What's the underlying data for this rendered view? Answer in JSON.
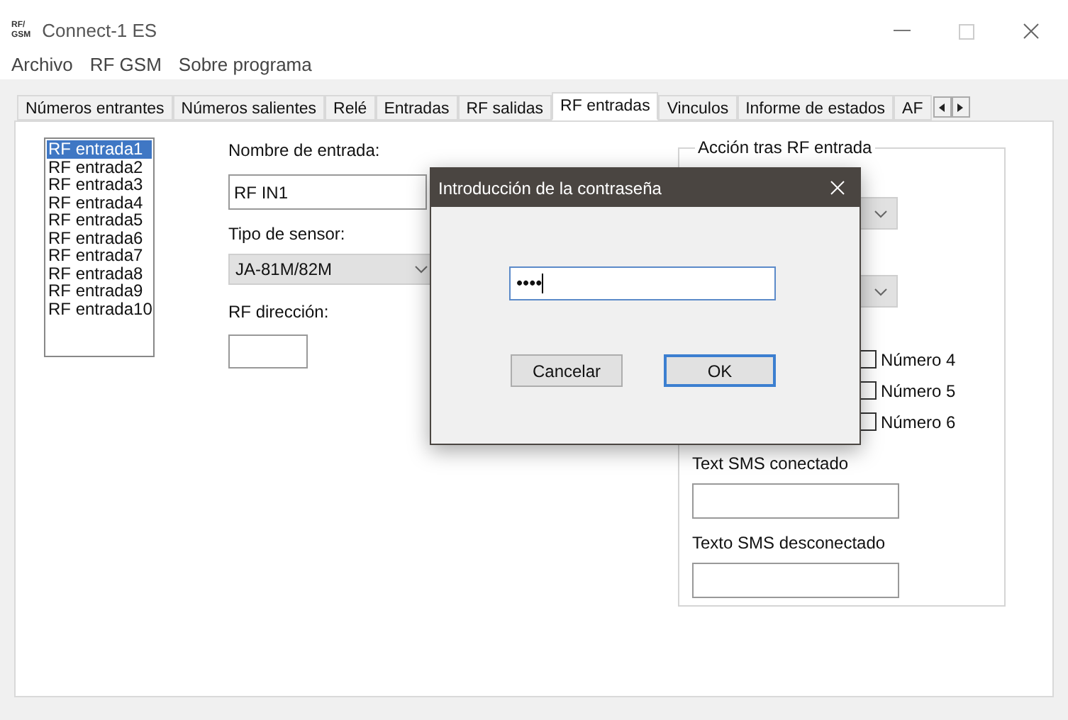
{
  "window": {
    "title": "Connect-1 ES",
    "logo": "RF/\nGSM"
  },
  "menu": [
    "Archivo",
    "RF GSM",
    "Sobre programa"
  ],
  "tabs": [
    {
      "label": "Números entrantes",
      "selected": false
    },
    {
      "label": "Números salientes",
      "selected": false
    },
    {
      "label": "Relé",
      "selected": false
    },
    {
      "label": "Entradas",
      "selected": false
    },
    {
      "label": "RF salidas",
      "selected": false
    },
    {
      "label": "RF entradas",
      "selected": true
    },
    {
      "label": "Vinculos",
      "selected": false
    },
    {
      "label": "Informe de estados",
      "selected": false
    },
    {
      "label": "AF",
      "selected": false
    }
  ],
  "inputs_list": [
    {
      "label": "RF entrada1",
      "selected": true
    },
    {
      "label": "RF entrada2",
      "selected": false
    },
    {
      "label": "RF entrada3",
      "selected": false
    },
    {
      "label": "RF entrada4",
      "selected": false
    },
    {
      "label": "RF entrada5",
      "selected": false
    },
    {
      "label": "RF entrada6",
      "selected": false
    },
    {
      "label": "RF entrada7",
      "selected": false
    },
    {
      "label": "RF entrada8",
      "selected": false
    },
    {
      "label": "RF entrada9",
      "selected": false
    },
    {
      "label": "RF entrada10",
      "selected": false
    }
  ],
  "form": {
    "name_label": "Nombre de entrada:",
    "name_value": "RF IN1",
    "sensor_label": "Tipo de sensor:",
    "sensor_value": "JA-81M/82M",
    "address_label": "RF dirección:"
  },
  "action_group": {
    "title": "Acción tras RF entrada",
    "numbers": [
      {
        "label": "Número 4",
        "checked": false
      },
      {
        "label": "Número 5",
        "checked": false
      },
      {
        "label": "Número 6",
        "checked": false
      }
    ],
    "sms_on_label": "Text SMS conectado",
    "sms_off_label": "Texto SMS desconectado"
  },
  "dialog": {
    "title": "Introducción de la contraseña",
    "password": "••••",
    "buttons": [
      {
        "label": "Cancelar",
        "default": false
      },
      {
        "label": "OK",
        "default": true
      }
    ]
  }
}
